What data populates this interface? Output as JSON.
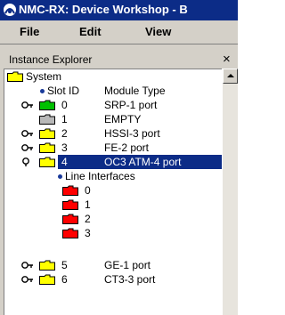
{
  "window": {
    "title": "NMC-RX: Device Workshop - B"
  },
  "menu": [
    "File",
    "Edit",
    "View"
  ],
  "panel": {
    "title": "Instance Explorer",
    "close_label": "×"
  },
  "tree": {
    "root_label": "System",
    "header": {
      "slot_label": "Slot ID",
      "module_label": "Module Type"
    },
    "slots": [
      {
        "id": "0",
        "module": "SRP-1 port",
        "folder_color": "#00c000"
      },
      {
        "id": "1",
        "module": "EMPTY",
        "folder_color": "#b8b8b8"
      },
      {
        "id": "2",
        "module": "HSSI-3 port",
        "folder_color": "#ffff00"
      },
      {
        "id": "3",
        "module": "FE-2 port",
        "folder_color": "#ffff00"
      },
      {
        "id": "4",
        "module": "OC3 ATM-4 port",
        "folder_color": "#ffff00",
        "selected": true
      },
      {
        "id": "5",
        "module": "GE-1 port",
        "folder_color": "#ffff00"
      },
      {
        "id": "6",
        "module": "CT3-3 port",
        "folder_color": "#ffff00"
      }
    ],
    "line_interfaces": {
      "label": "Line Interfaces",
      "items": [
        "0",
        "1",
        "2",
        "3"
      ],
      "folder_color": "#ff0000"
    }
  }
}
